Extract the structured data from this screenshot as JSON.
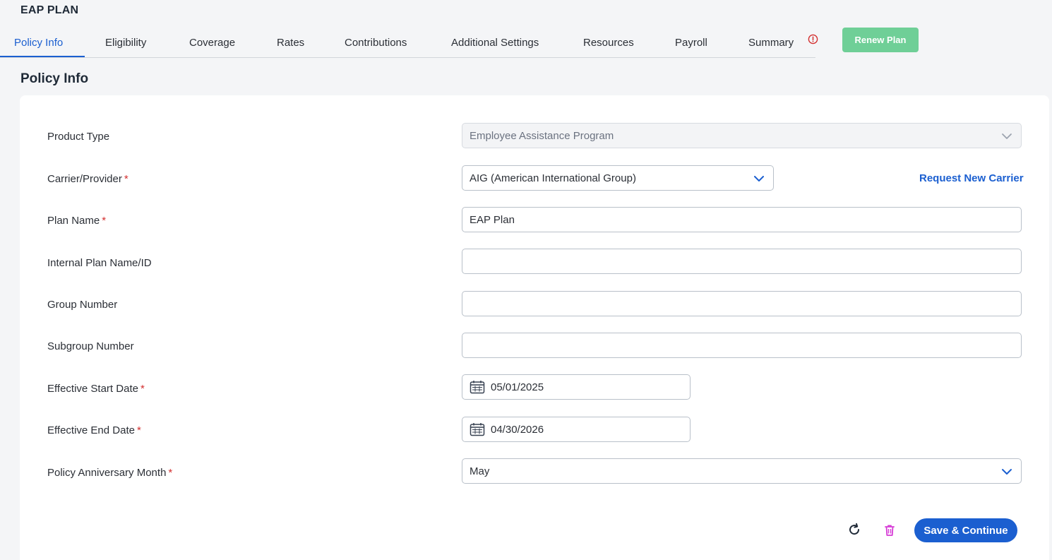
{
  "app": {
    "title": "EAP PLAN"
  },
  "tabs": [
    {
      "label": "Policy Info",
      "active": true
    },
    {
      "label": "Eligibility"
    },
    {
      "label": "Coverage"
    },
    {
      "label": "Rates"
    },
    {
      "label": "Contributions"
    },
    {
      "label": "Additional Settings"
    },
    {
      "label": "Resources"
    },
    {
      "label": "Payroll"
    },
    {
      "label": "Summary",
      "icon": "alert-circle-icon"
    }
  ],
  "header_actions": {
    "renew_label": "Renew Plan"
  },
  "section": {
    "title": "Policy Info"
  },
  "form": {
    "product_type": {
      "label": "Product Type",
      "value": "Employee Assistance Program"
    },
    "carrier": {
      "label": "Carrier/Provider",
      "value": "AIG (American International Group)",
      "request_link": "Request New Carrier"
    },
    "plan_name": {
      "label": "Plan Name",
      "value": "EAP Plan"
    },
    "internal_plan": {
      "label": "Internal Plan Name/ID",
      "value": ""
    },
    "group_number": {
      "label": "Group Number",
      "value": ""
    },
    "subgroup_number": {
      "label": "Subgroup Number",
      "value": ""
    },
    "start_date": {
      "label": "Effective Start Date",
      "value": "05/01/2025"
    },
    "end_date": {
      "label": "Effective End Date",
      "value": "04/30/2026"
    },
    "anniversary_month": {
      "label": "Policy Anniversary Month",
      "value": "May"
    },
    "required_mark": "*"
  },
  "footer": {
    "save_label": "Save & Continue"
  },
  "colors": {
    "primary": "#1b5fd0",
    "renew": "#6fcf97",
    "required": "#d32f2f",
    "delete": "#d63bd6"
  }
}
